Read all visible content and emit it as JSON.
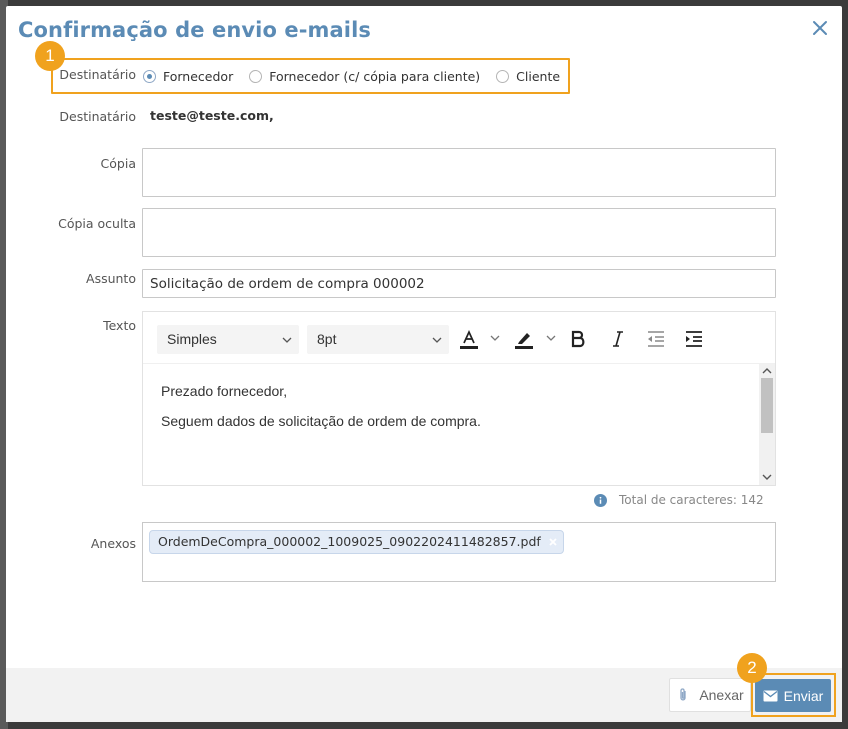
{
  "dialog": {
    "title": "Confirmação de envio e-mails"
  },
  "recipient_type": {
    "label": "Destinatário",
    "options": [
      {
        "label": "Fornecedor",
        "checked": true
      },
      {
        "label": "Fornecedor (c/ cópia para cliente)",
        "checked": false
      },
      {
        "label": "Cliente",
        "checked": false
      }
    ]
  },
  "recipient": {
    "label": "Destinatário",
    "value": "teste@teste.com,"
  },
  "cc": {
    "label": "Cópia",
    "value": ""
  },
  "bcc": {
    "label": "Cópia oculta",
    "value": ""
  },
  "subject": {
    "label": "Assunto",
    "value": "Solicitação de ordem de compra 000002"
  },
  "body": {
    "label": "Texto",
    "font_family": "Simples",
    "font_size": "8pt",
    "lines": [
      "Prezado fornecedor,",
      "Seguem dados de solicitação de ordem de compra."
    ],
    "char_count_label": "Total de caracteres: 142"
  },
  "attachments": {
    "label": "Anexos",
    "files": [
      "OrdemDeCompra_000002_1009025_0902202411482857.pdf"
    ]
  },
  "footer": {
    "attach_label": "Anexar",
    "send_label": "Enviar"
  },
  "callouts": [
    "1",
    "2"
  ],
  "colors": {
    "accent": "#5b8bb5",
    "highlight": "#f0a21e"
  }
}
